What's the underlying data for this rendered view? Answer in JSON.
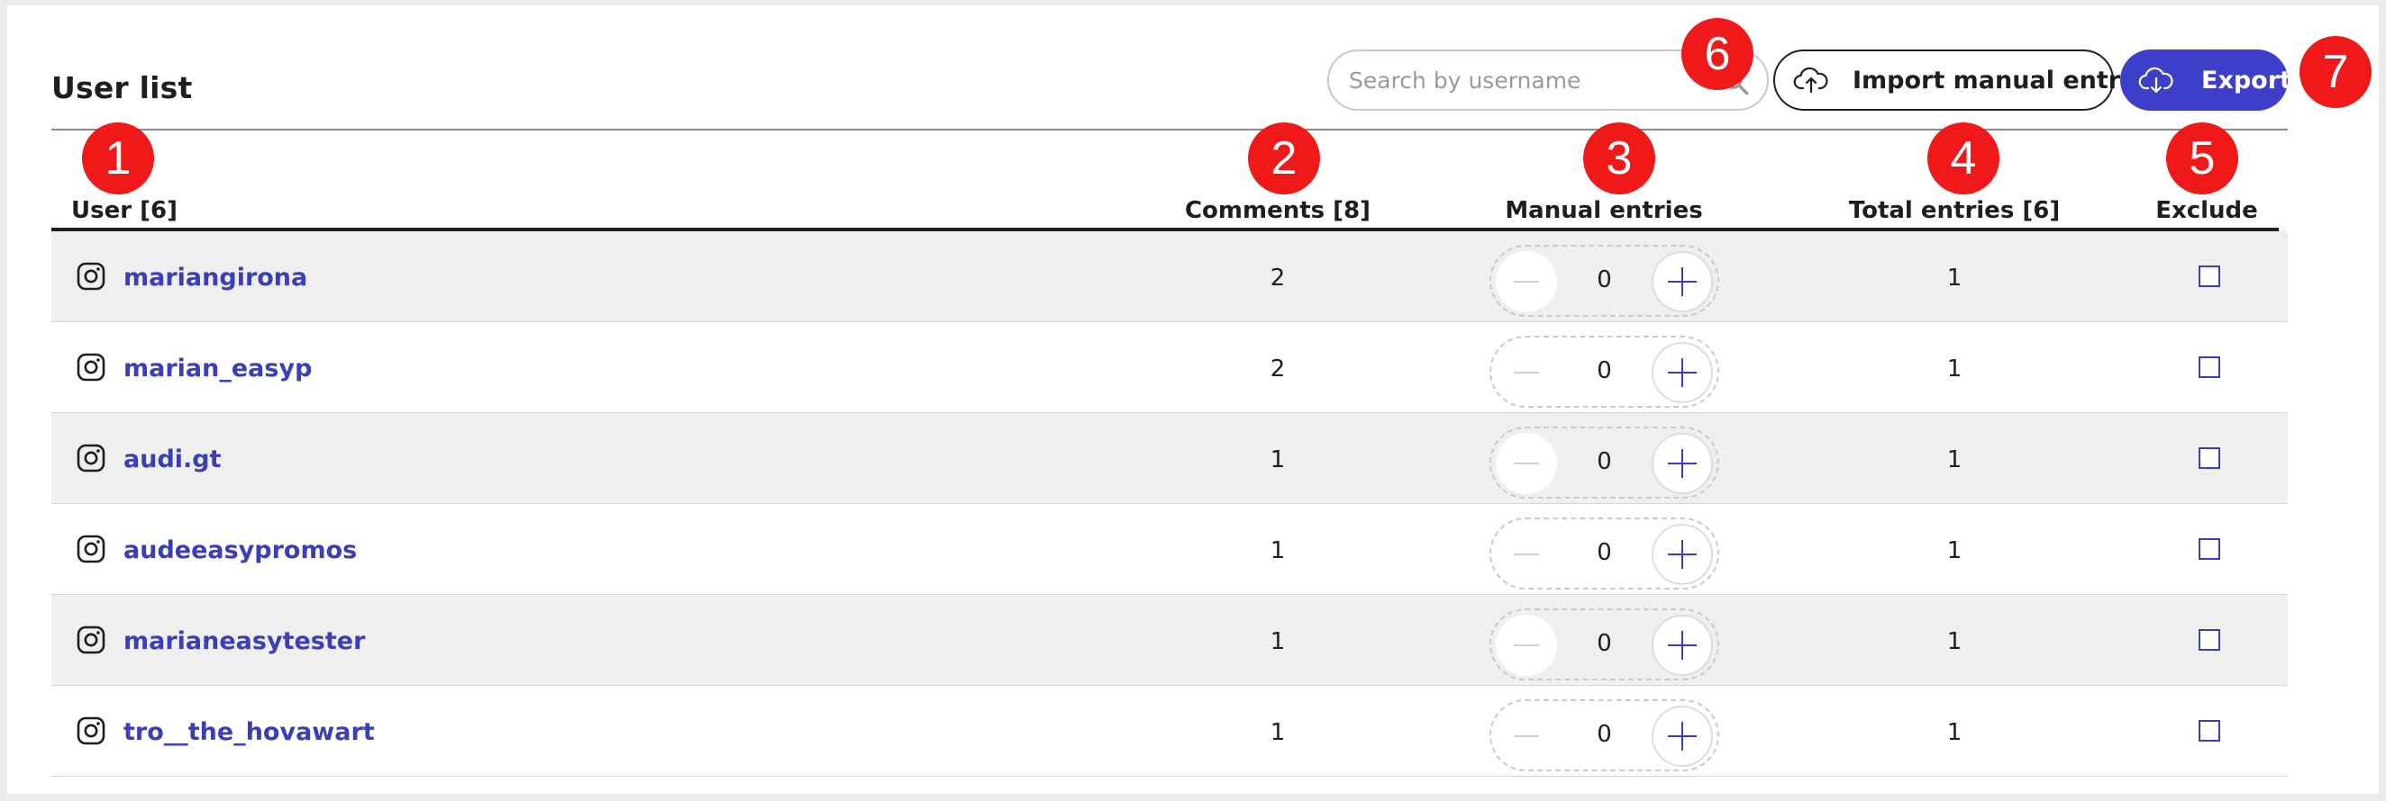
{
  "title": "User list",
  "search": {
    "placeholder": "Search by username"
  },
  "toolbar": {
    "import_label": "Import manual entries",
    "export_label": "Export"
  },
  "columns": {
    "user": "User [6]",
    "comments": "Comments [8]",
    "manual": "Manual entries",
    "total": "Total entries [6]",
    "exclude": "Exclude"
  },
  "rows": [
    {
      "username": "mariangirona",
      "comments": "2",
      "manual": "0",
      "total": "1"
    },
    {
      "username": "marian_easyp",
      "comments": "2",
      "manual": "0",
      "total": "1"
    },
    {
      "username": "audi.gt",
      "comments": "1",
      "manual": "0",
      "total": "1"
    },
    {
      "username": "audeeasypromos",
      "comments": "1",
      "manual": "0",
      "total": "1"
    },
    {
      "username": "marianeasytester",
      "comments": "1",
      "manual": "0",
      "total": "1"
    },
    {
      "username": "tro__the_hovawart",
      "comments": "1",
      "manual": "0",
      "total": "1"
    }
  ],
  "badges": [
    "1",
    "2",
    "3",
    "4",
    "5",
    "6",
    "7"
  ],
  "icons": {
    "row": "instagram-icon",
    "import": "cloud-upload-icon",
    "export": "cloud-download-icon",
    "search": "search-icon",
    "minus": "minus-icon",
    "plus": "plus-icon"
  },
  "colors": {
    "accent": "#3d3ec9",
    "link": "#3a3eb8",
    "badge": "#f01919",
    "row_alt": "#efefef"
  }
}
